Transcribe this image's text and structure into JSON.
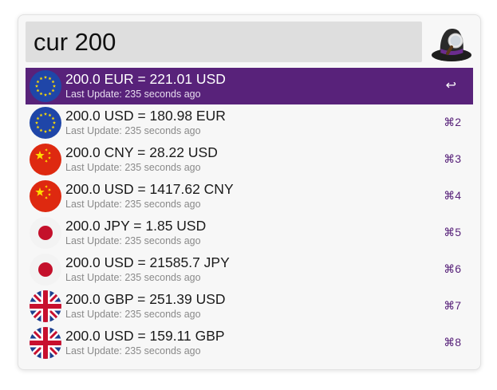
{
  "search": {
    "query": "cur 200"
  },
  "results": [
    {
      "title": "200.0 EUR = 221.01 USD",
      "subtitle": "Last Update: 235 seconds ago",
      "shortcut": "↩",
      "flag": "eu-flag-icon",
      "selected": true
    },
    {
      "title": "200.0 USD = 180.98 EUR",
      "subtitle": "Last Update: 235 seconds ago",
      "shortcut": "⌘2",
      "flag": "eu-flag-icon",
      "selected": false
    },
    {
      "title": "200.0 CNY = 28.22 USD",
      "subtitle": "Last Update: 235 seconds ago",
      "shortcut": "⌘3",
      "flag": "china-flag-icon",
      "selected": false
    },
    {
      "title": "200.0 USD = 1417.62 CNY",
      "subtitle": "Last Update: 235 seconds ago",
      "shortcut": "⌘4",
      "flag": "china-flag-icon",
      "selected": false
    },
    {
      "title": "200.0 JPY = 1.85 USD",
      "subtitle": "Last Update: 235 seconds ago",
      "shortcut": "⌘5",
      "flag": "japan-flag-icon",
      "selected": false
    },
    {
      "title": "200.0 USD = 21585.7 JPY",
      "subtitle": "Last Update: 235 seconds ago",
      "shortcut": "⌘6",
      "flag": "japan-flag-icon",
      "selected": false
    },
    {
      "title": "200.0 GBP = 251.39 USD",
      "subtitle": "Last Update: 235 seconds ago",
      "shortcut": "⌘7",
      "flag": "uk-flag-icon",
      "selected": false
    },
    {
      "title": "200.0 USD = 159.11 GBP",
      "subtitle": "Last Update: 235 seconds ago",
      "shortcut": "⌘8",
      "flag": "uk-flag-icon",
      "selected": false
    }
  ],
  "colors": {
    "accent": "#58227a",
    "search_bg": "#dedede",
    "window_bg": "#f7f7f7",
    "subtitle": "#8a8a8a"
  }
}
